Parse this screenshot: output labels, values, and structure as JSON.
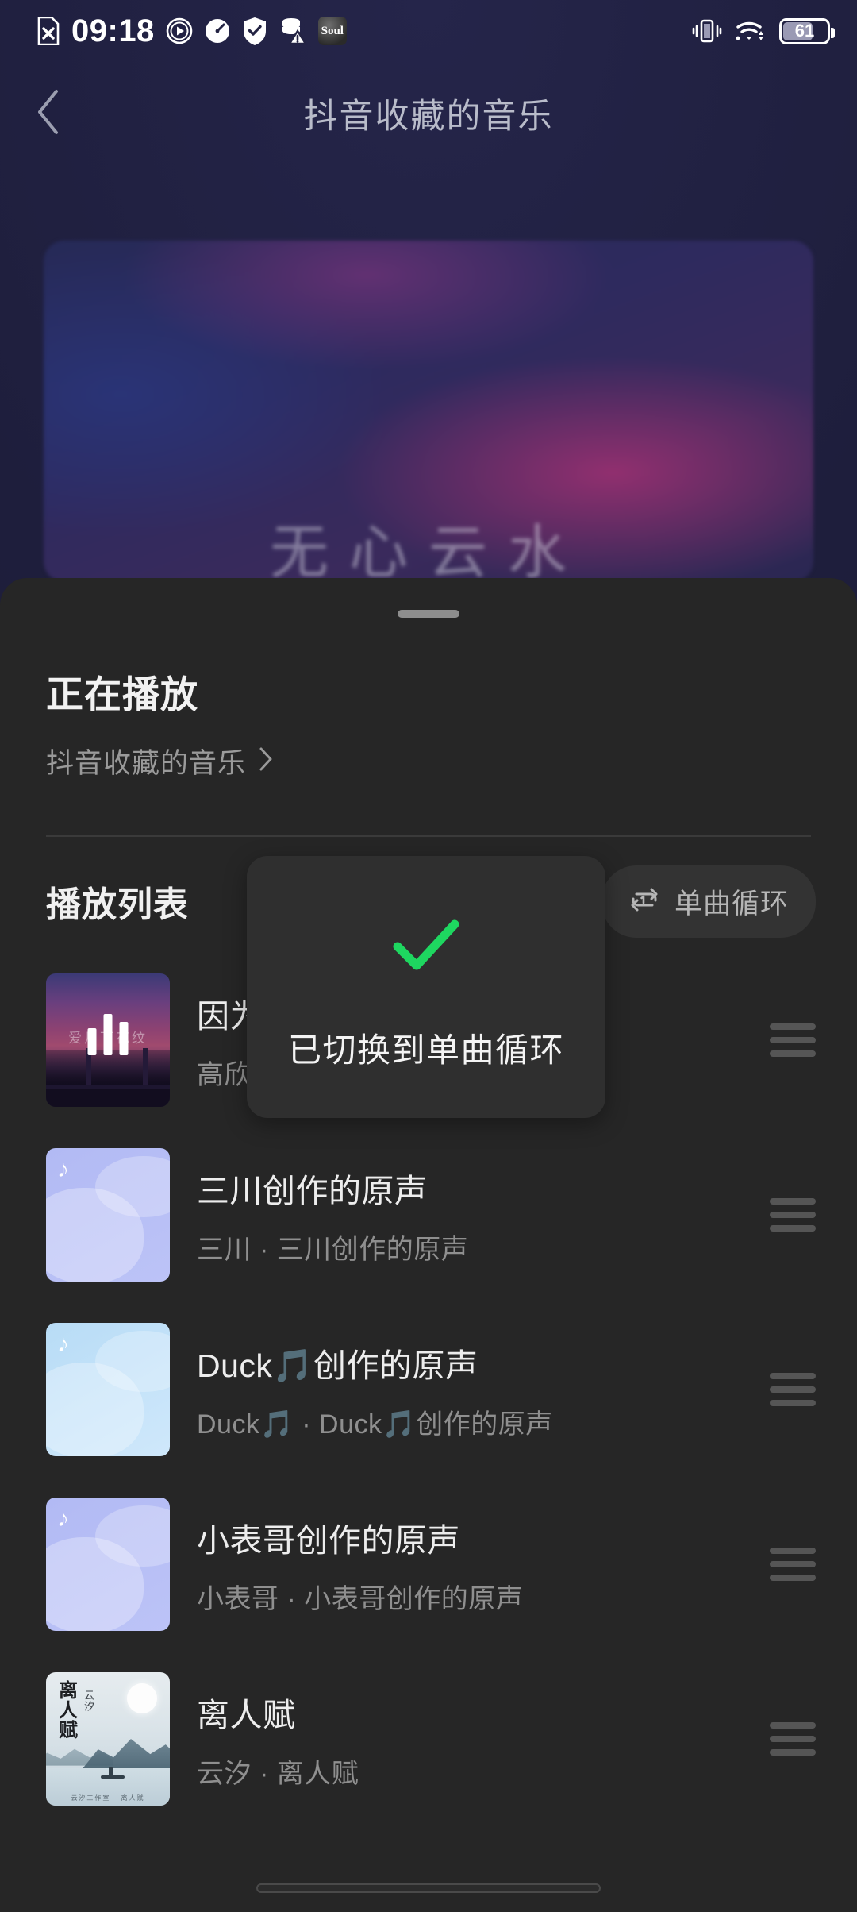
{
  "status_bar": {
    "time": "09:18",
    "battery_percent": "61",
    "left_icons": [
      "document-x-icon",
      "play-circle-icon",
      "speedometer-icon",
      "shield-check-icon",
      "database-warning-icon"
    ],
    "app_badge_label": "Soul",
    "right_icons": [
      "vibrate-icon",
      "wifi-icon",
      "battery-icon"
    ]
  },
  "header": {
    "back_icon": "chevron-left-icon",
    "title": "抖音收藏的音乐"
  },
  "hero": {
    "calligraphy": "无心云水"
  },
  "sheet": {
    "now_playing_label": "正在播放",
    "now_playing_source": "抖音收藏的音乐",
    "source_chevron": "chevron-right-icon",
    "playlist_label": "播放列表",
    "loop_mode_label": "单曲循环",
    "loop_mode_icon": "repeat-one-icon"
  },
  "toast": {
    "icon": "check-icon",
    "icon_color": "#1ed760",
    "message": "已切换到单曲循环"
  },
  "songs": [
    {
      "name": "因为爱情",
      "artist": "高欣 · 因为爱情",
      "art": "sunset",
      "playing": true,
      "handle_icon": "drag-handle-icon"
    },
    {
      "name": "三川创作的原声",
      "artist": "三川 · 三川创作的原声",
      "art": "placeholder-violet",
      "playing": false,
      "handle_icon": "drag-handle-icon"
    },
    {
      "name": "Duck🎵创作的原声",
      "artist": "Duck🎵 · Duck🎵创作的原声",
      "art": "placeholder-blue",
      "playing": false,
      "handle_icon": "drag-handle-icon"
    },
    {
      "name": "小表哥创作的原声",
      "artist": "小表哥 · 小表哥创作的原声",
      "art": "placeholder-violet",
      "playing": false,
      "handle_icon": "drag-handle-icon"
    },
    {
      "name": "离人赋",
      "artist": "云汐 · 离人赋",
      "art": "ink",
      "playing": false,
      "handle_icon": "drag-handle-icon"
    }
  ],
  "colors": {
    "sheet_bg": "#262626",
    "page_bg": "#232343",
    "accent_green": "#1ed760",
    "text_primary": "#ededed",
    "text_secondary": "#8f8f8f"
  }
}
